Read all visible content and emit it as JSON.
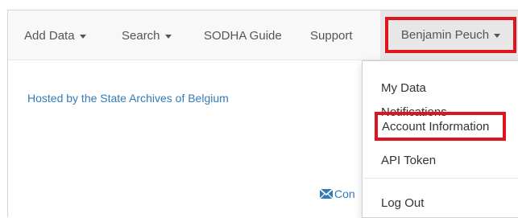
{
  "navbar": {
    "items": [
      {
        "label": "Add Data"
      },
      {
        "label": "Search"
      },
      {
        "label": "SODHA Guide"
      },
      {
        "label": "Support"
      }
    ],
    "user_menu_label": "Benjamin Peuch"
  },
  "main": {
    "hosted_link": "Hosted by the State Archives of Belgium",
    "contact_partial": "Con"
  },
  "dropdown": {
    "items": [
      {
        "label": "My Data"
      },
      {
        "label": "Notifications"
      },
      {
        "label": "Account Information"
      },
      {
        "label": "API Token"
      },
      {
        "label": "Log Out"
      }
    ]
  },
  "colors": {
    "highlight": "#e0141e",
    "link": "#337ab7",
    "navbar_bg": "#f8f8f8"
  },
  "icons": {
    "caret": "caret-down-icon",
    "contact": "envelope-icon"
  }
}
